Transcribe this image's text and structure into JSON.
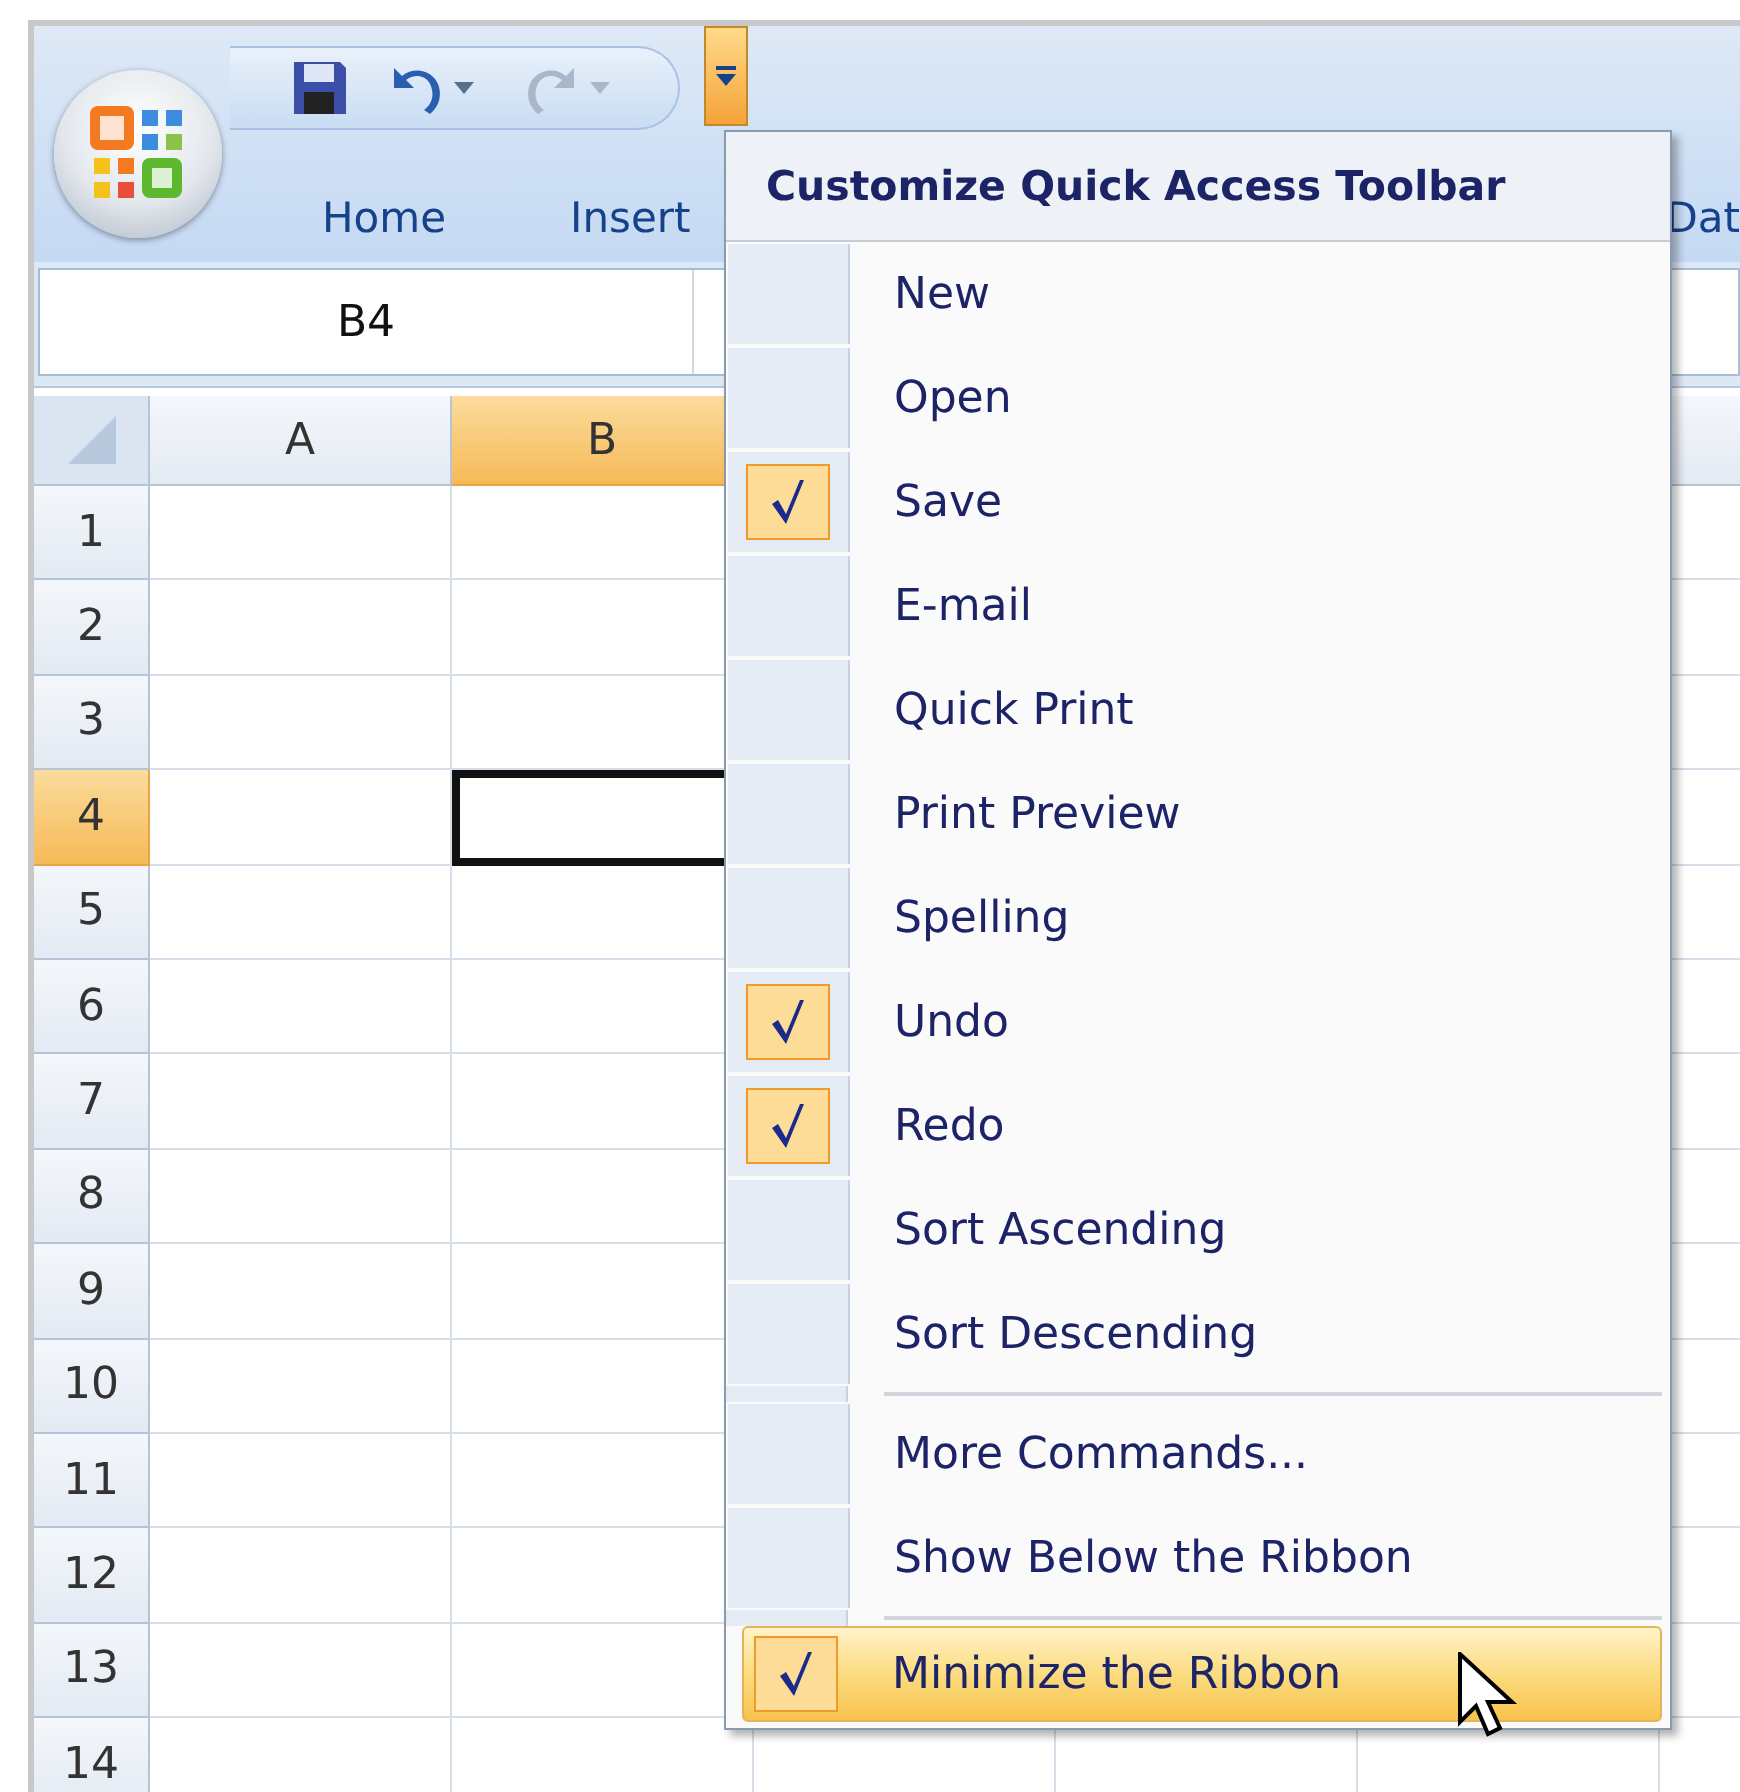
{
  "quick_access_toolbar": {
    "buttons": [
      {
        "kind": "save",
        "disabled": false,
        "has_dropdown": false
      },
      {
        "kind": "undo",
        "disabled": false,
        "has_dropdown": true
      },
      {
        "kind": "redo",
        "disabled": true,
        "has_dropdown": true
      }
    ],
    "customize_open": true
  },
  "tabs": [
    {
      "label": "Home",
      "selected": false
    },
    {
      "label": "Insert",
      "selected": false
    },
    {
      "label": "Dat",
      "selected": false
    }
  ],
  "name_box": {
    "value": "B4"
  },
  "sheet": {
    "columns": [
      {
        "label": "A",
        "selected": false
      },
      {
        "label": "B",
        "selected": true
      }
    ],
    "rows": [
      {
        "label": "1",
        "selected": false
      },
      {
        "label": "2",
        "selected": false
      },
      {
        "label": "3",
        "selected": false
      },
      {
        "label": "4",
        "selected": true
      },
      {
        "label": "5",
        "selected": false
      },
      {
        "label": "6",
        "selected": false
      },
      {
        "label": "7",
        "selected": false
      },
      {
        "label": "8",
        "selected": false
      },
      {
        "label": "9",
        "selected": false
      },
      {
        "label": "10",
        "selected": false
      },
      {
        "label": "11",
        "selected": false
      },
      {
        "label": "12",
        "selected": false
      },
      {
        "label": "13",
        "selected": false
      },
      {
        "label": "14",
        "selected": false
      }
    ]
  },
  "menu": {
    "title": "Customize Quick Access Toolbar",
    "items": [
      {
        "kind": "option",
        "label": "New",
        "checked": false,
        "highlighted": false
      },
      {
        "kind": "option",
        "label": "Open",
        "checked": false,
        "highlighted": false
      },
      {
        "kind": "option",
        "label": "Save",
        "checked": true,
        "highlighted": false
      },
      {
        "kind": "option",
        "label": "E-mail",
        "checked": false,
        "highlighted": false
      },
      {
        "kind": "option",
        "label": "Quick Print",
        "checked": false,
        "highlighted": false
      },
      {
        "kind": "option",
        "label": "Print Preview",
        "checked": false,
        "highlighted": false
      },
      {
        "kind": "option",
        "label": "Spelling",
        "checked": false,
        "highlighted": false
      },
      {
        "kind": "option",
        "label": "Undo",
        "checked": true,
        "highlighted": false
      },
      {
        "kind": "option",
        "label": "Redo",
        "checked": true,
        "highlighted": false
      },
      {
        "kind": "option",
        "label": "Sort Ascending",
        "checked": false,
        "highlighted": false
      },
      {
        "kind": "option",
        "label": "Sort Descending",
        "checked": false,
        "highlighted": false
      },
      {
        "kind": "separator"
      },
      {
        "kind": "option",
        "label": "More Commands...",
        "checked": false,
        "highlighted": false
      },
      {
        "kind": "option",
        "label": "Show Below the Ribbon",
        "checked": false,
        "highlighted": false
      },
      {
        "kind": "separator"
      },
      {
        "kind": "option",
        "label": "Minimize the Ribbon",
        "checked": true,
        "highlighted": true
      }
    ]
  }
}
